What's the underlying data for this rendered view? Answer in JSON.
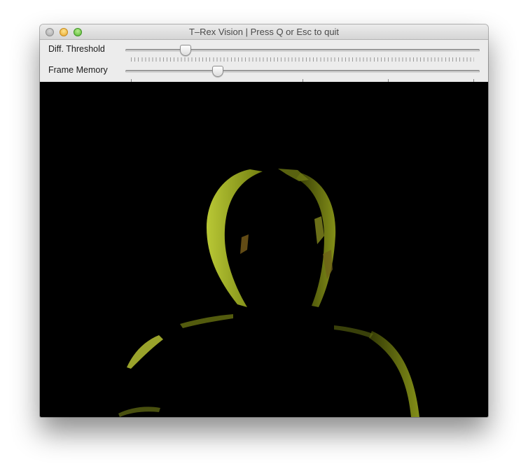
{
  "window": {
    "title": "T–Rex Vision | Press Q or Esc to quit",
    "buttons": {
      "close": "close-button",
      "minimize": "minimize-button",
      "zoom": "zoom-button"
    }
  },
  "controls": {
    "diff_threshold": {
      "label": "Diff. Threshold",
      "level_fraction": 0.17
    },
    "frame_memory": {
      "label": "Frame Memory",
      "level_fraction": 0.26
    }
  },
  "video": {
    "content": "Motion-difference view of a person's head and shoulders with yellow-green highlights along edges on a black background"
  }
}
